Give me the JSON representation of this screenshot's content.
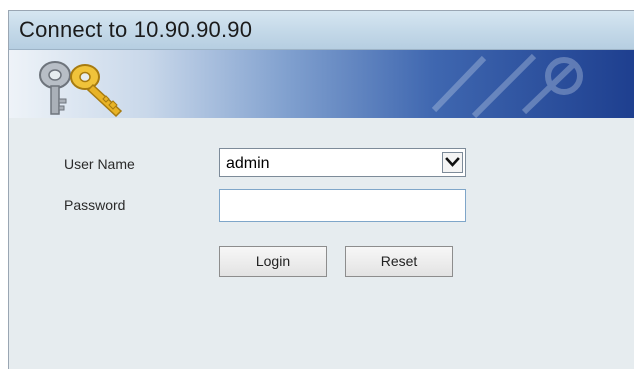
{
  "window": {
    "title": "Connect to 10.90.90.90"
  },
  "banner": {
    "icon": "keys-icon"
  },
  "form": {
    "user_name_label": "User Name",
    "user_name_value": "admin",
    "password_label": "Password",
    "password_value": ""
  },
  "buttons": {
    "login_label": "Login",
    "reset_label": "Reset"
  },
  "colors": {
    "banner_dark": "#1e3f8f",
    "body_background": "#e6ecef",
    "input_border": "#7fa6c9"
  }
}
